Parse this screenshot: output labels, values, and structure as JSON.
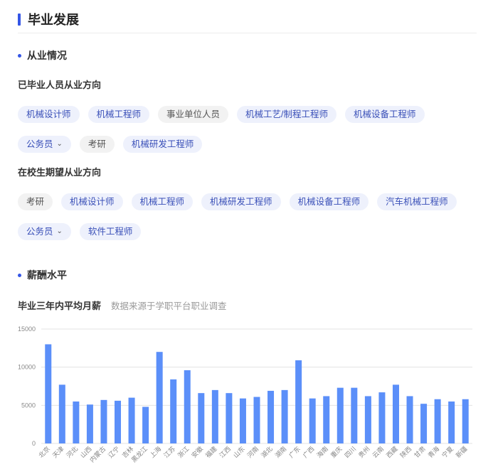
{
  "page": {
    "title": "毕业发展"
  },
  "employment": {
    "heading": "从业情况",
    "graduated_label": "已毕业人员从业方向",
    "graduated_tags": [
      {
        "label": "机械设计师",
        "style": "blue"
      },
      {
        "label": "机械工程师",
        "style": "blue"
      },
      {
        "label": "事业单位人员",
        "style": "gray"
      },
      {
        "label": "机械工艺/制程工程师",
        "style": "blue"
      },
      {
        "label": "机械设备工程师",
        "style": "blue"
      },
      {
        "label": "公务员",
        "style": "blue",
        "dropdown": true
      },
      {
        "label": "考研",
        "style": "gray"
      },
      {
        "label": "机械研发工程师",
        "style": "blue"
      }
    ],
    "student_label": "在校生期望从业方向",
    "student_tags": [
      {
        "label": "考研",
        "style": "gray"
      },
      {
        "label": "机械设计师",
        "style": "blue"
      },
      {
        "label": "机械工程师",
        "style": "blue"
      },
      {
        "label": "机械研发工程师",
        "style": "blue"
      },
      {
        "label": "机械设备工程师",
        "style": "blue"
      },
      {
        "label": "汽车机械工程师",
        "style": "blue"
      },
      {
        "label": "公务员",
        "style": "blue",
        "dropdown": true
      },
      {
        "label": "软件工程师",
        "style": "blue"
      }
    ]
  },
  "salary": {
    "heading": "薪酬水平",
    "caption": "毕业三年内平均月薪",
    "source_note": "数据来源于学职平台职业调查"
  },
  "colors": {
    "accent": "#3556e6",
    "bar": "#5b8ff9",
    "tag_blue_bg": "#eef1fc",
    "tag_gray_bg": "#f2f2f2"
  },
  "chart_data": {
    "type": "bar",
    "categories": [
      "北京",
      "天津",
      "河北",
      "山西",
      "内蒙古",
      "辽宁",
      "吉林",
      "黑龙江",
      "上海",
      "江苏",
      "浙江",
      "安徽",
      "福建",
      "江西",
      "山东",
      "河南",
      "湖北",
      "湖南",
      "广东",
      "广西",
      "海南",
      "重庆",
      "四川",
      "贵州",
      "云南",
      "西藏",
      "陕西",
      "甘肃",
      "青海",
      "宁夏",
      "新疆"
    ],
    "values": [
      13000,
      7700,
      5500,
      5100,
      5700,
      5600,
      6000,
      4800,
      12000,
      8400,
      9600,
      6600,
      7000,
      6600,
      5900,
      6100,
      6900,
      7000,
      10900,
      5900,
      6200,
      7300,
      7300,
      6200,
      6700,
      7700,
      6200,
      5200,
      5800,
      5500,
      5800
    ],
    "yticks": [
      0,
      5000,
      10000,
      15000
    ],
    "ylim": [
      0,
      15000
    ],
    "grid": true,
    "title": "",
    "xlabel": "",
    "ylabel": ""
  }
}
